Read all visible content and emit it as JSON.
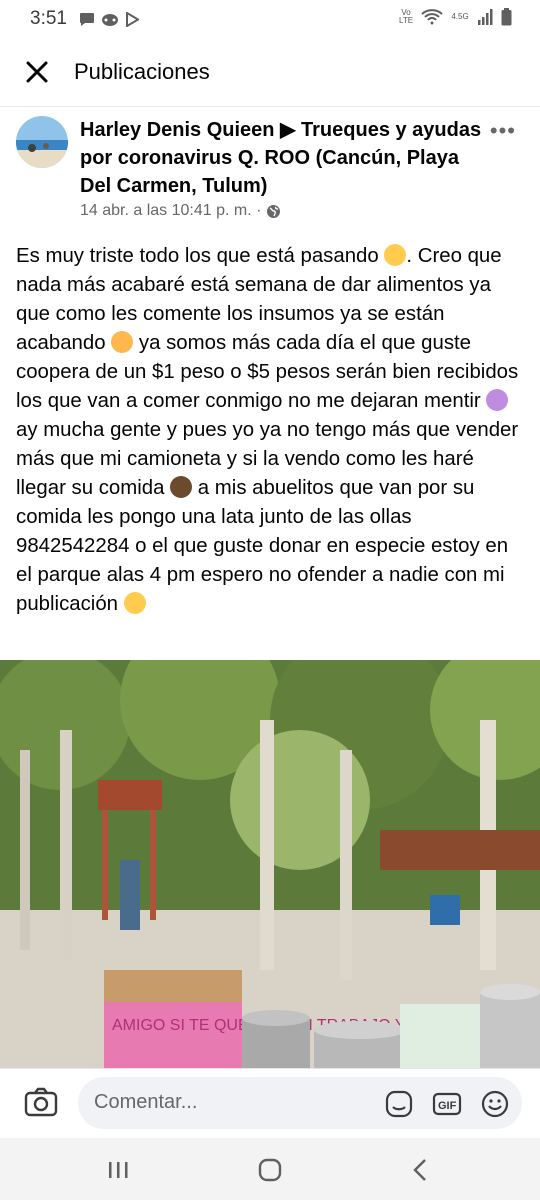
{
  "status": {
    "time": "3:51",
    "network_label": "Vo LTE",
    "signal_label": "4.5G"
  },
  "topbar": {
    "title": "Publicaciones"
  },
  "post": {
    "author": "Harley Denis Quieen",
    "group": "Trueques y ayudas por coronavirus Q. ROO (Cancún, Playa Del Carmen, Tulum)",
    "timestamp": "14 abr. a las 10:41 p. m. ·",
    "body": [
      "Es muy triste todo los que está pasando ",
      ". Creo que nada más acabaré está semana  de dar alimentos ya que como les comente los insumos ya se están acabando ",
      " ya somos más cada día el que guste coopera de un $1 peso o $5 pesos serán bien recibidos los que van a comer conmigo no me dejaran mentir ",
      "ay mucha gente y pues yo ya no tengo más que vender más que mi camioneta y si la vendo como les haré llegar su comida ",
      " a mis abuelitos que van por su comida les pongo una lata junto de las ollas 9842542284 o el que guste donar en especie estoy en el parque alas 4 pm espero no ofender a nadie con mi publicación "
    ],
    "photo_sign_text": "AMIGO SI TE QUEDAS SIN TRABAJO Y"
  },
  "comment": {
    "placeholder": "Comentar..."
  },
  "colors": {
    "muted": "#65676b",
    "input_bg": "#f0f2f5",
    "divider": "#e4e6eb"
  }
}
